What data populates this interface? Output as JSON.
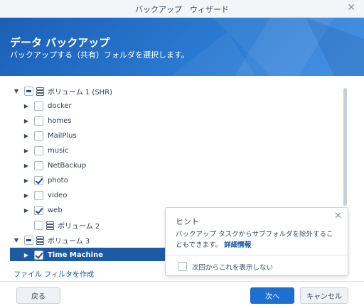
{
  "window": {
    "title": "バックアップ　ウィザード"
  },
  "banner": {
    "title": "データ バックアップ",
    "subtitle": "バックアップする（共有）フォルダを選択します。"
  },
  "tree": {
    "items": [
      {
        "label": "ボリューム 1 (SHR)",
        "arrow": "▼",
        "check": "partial",
        "volume": true,
        "indent": 0,
        "selected": false
      },
      {
        "label": "docker",
        "arrow": "▶",
        "check": "unchecked",
        "volume": false,
        "indent": 1,
        "selected": false
      },
      {
        "label": "homes",
        "arrow": "▶",
        "check": "unchecked",
        "volume": false,
        "indent": 1,
        "selected": false
      },
      {
        "label": "MailPlus",
        "arrow": "▶",
        "check": "unchecked",
        "volume": false,
        "indent": 1,
        "selected": false
      },
      {
        "label": "music",
        "arrow": "▶",
        "check": "unchecked",
        "volume": false,
        "indent": 1,
        "selected": false
      },
      {
        "label": "NetBackup",
        "arrow": "▶",
        "check": "unchecked",
        "volume": false,
        "indent": 1,
        "selected": false
      },
      {
        "label": "photo",
        "arrow": "▶",
        "check": "checked",
        "volume": false,
        "indent": 1,
        "selected": false
      },
      {
        "label": "video",
        "arrow": "▶",
        "check": "unchecked",
        "volume": false,
        "indent": 1,
        "selected": false
      },
      {
        "label": "web",
        "arrow": "▶",
        "check": "checked",
        "volume": false,
        "indent": 1,
        "selected": false
      },
      {
        "label": "ボリューム 2",
        "arrow": "",
        "check": "unchecked",
        "volume": true,
        "indent": 1,
        "selected": false
      },
      {
        "label": "ボリューム 3",
        "arrow": "▼",
        "check": "partial",
        "volume": true,
        "indent": 0,
        "selected": false
      },
      {
        "label": "Time Machine",
        "arrow": "▶",
        "check": "checked",
        "volume": false,
        "indent": 1,
        "selected": true
      }
    ]
  },
  "filter_link": "ファイル フィルタを作成",
  "hint": {
    "title": "ヒント",
    "body": "バックアップ タスクからサブフォルダを除外することもできます。",
    "link": "詳細情報",
    "dont_show": "次回からこれを表示しない"
  },
  "footer": {
    "back": "戻る",
    "next": "次へ",
    "cancel": "キャンセル"
  },
  "colors": {
    "banner": "#2a79d1",
    "selected_row": "#1d5aa6",
    "primary_button": "#1d6fd0",
    "link": "#1d5aa6"
  }
}
